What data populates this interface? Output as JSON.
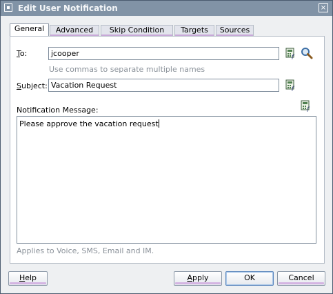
{
  "window": {
    "title": "Edit User Notification",
    "close_glyph": "×"
  },
  "tabs": [
    {
      "label": "General",
      "active": true
    },
    {
      "label": "Advanced",
      "active": false
    },
    {
      "label": "Skip Condition",
      "active": false
    },
    {
      "label": "Targets",
      "active": false
    },
    {
      "label": "Sources",
      "active": false
    }
  ],
  "form": {
    "to_label_mnemonic": "T",
    "to_label_rest": "o:",
    "to_value": "jcooper",
    "to_hint": "Use commas to separate multiple names",
    "subject_label_mnemonic": "S",
    "subject_label_rest": "ubject:",
    "subject_value": "Vacation Request",
    "message_label": "Notification Message:",
    "message_value": "Please approve the vacation request",
    "applies_note": "Applies to Voice, SMS, Email and IM."
  },
  "buttons": {
    "help_mnemonic": "H",
    "help_rest": "elp",
    "apply_mnemonic": "A",
    "apply_rest": "pply",
    "ok": "OK",
    "cancel": "Cancel"
  },
  "icons": {
    "expression_builder": "expression-builder-icon",
    "search": "search-icon"
  },
  "colors": {
    "titlebar": "#8193a6",
    "tab_accent": "#c8a8d8",
    "hint_text": "#8a9199",
    "ok_border": "#5a86bd"
  }
}
